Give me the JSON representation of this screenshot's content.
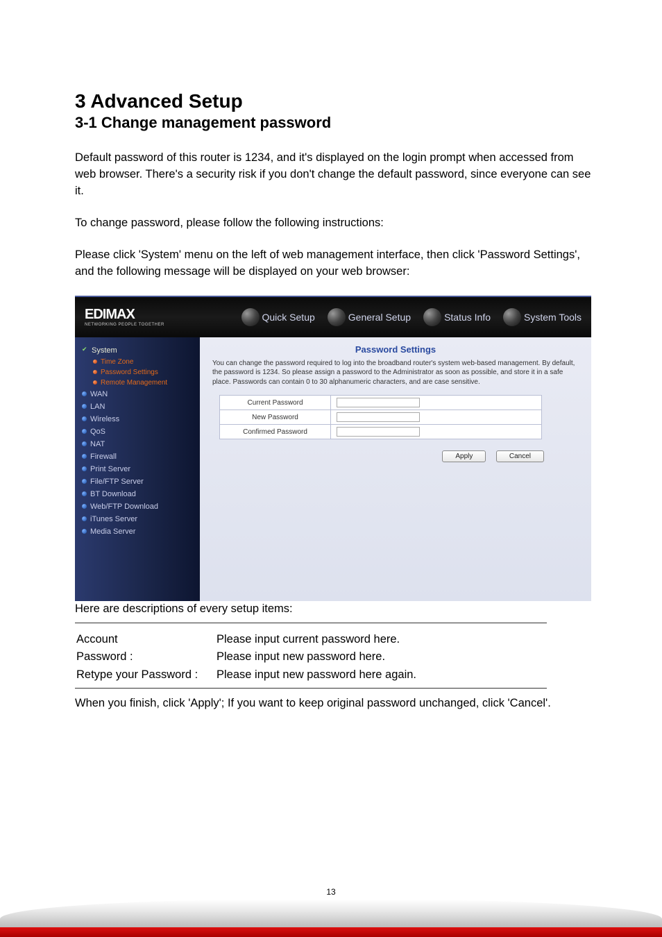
{
  "headings": {
    "h1": "3 Advanced Setup",
    "h2": "3-1 Change management password"
  },
  "paragraphs": {
    "p1": "Default password of this router is 1234, and it's displayed on the login prompt when accessed from web browser. There's a security risk if you don't change the default password, since everyone can see it.",
    "p2": "To change password, please follow the following instructions:",
    "p3": "Please click 'System' menu on the left of web management interface, then click 'Password Settings', and the following message will be displayed on your web browser:",
    "afterfig": "Here are descriptions of every setup items:",
    "closing": "When you finish, click 'Apply'; If you want to keep original password unchanged, click 'Cancel'."
  },
  "brand": {
    "name": "EDIMAX",
    "tagline": "NETWORKING PEOPLE TOGETHER"
  },
  "topnav": {
    "quick": "Quick Setup",
    "general": "General Setup",
    "status": "Status Info",
    "tools": "System Tools"
  },
  "sidebar": {
    "system": "System",
    "timezone": "Time Zone",
    "pwsettings": "Password Settings",
    "remote": "Remote Management",
    "wan": "WAN",
    "lan": "LAN",
    "wireless": "Wireless",
    "qos": "QoS",
    "nat": "NAT",
    "firewall": "Firewall",
    "print": "Print Server",
    "fileftp": "File/FTP Server",
    "bt": "BT Download",
    "webftp": "Web/FTP Download",
    "itunes": "iTunes Server",
    "media": "Media Server"
  },
  "panel": {
    "title": "Password Settings",
    "desc": "You can change the password required to log into the broadband router's system web-based management. By default, the password is 1234. So please assign a password to the Administrator as soon as possible, and store it in a safe place. Passwords can contain 0 to 30 alphanumeric characters, and are case sensitive.",
    "row1": "Current Password",
    "row2": "New Password",
    "row3": "Confirmed Password",
    "apply": "Apply",
    "cancel": "Cancel"
  },
  "desc_table": {
    "r1a": "Account",
    "r1b": "Please input current password here.",
    "r2a": "Password :",
    "r2b": "Please input new password here.",
    "r3a": "Retype your Password :",
    "r3b": "Please input new password here again."
  },
  "page_number": "13"
}
